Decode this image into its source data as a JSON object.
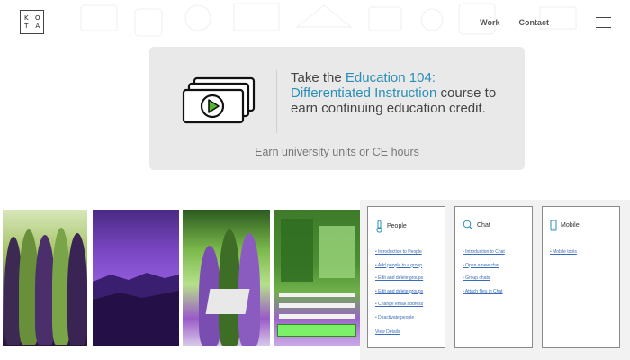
{
  "header": {
    "logo_letters": [
      "K",
      "O",
      "T",
      "A"
    ],
    "nav": [
      {
        "label": "Work"
      },
      {
        "label": "Contact"
      }
    ],
    "menu_icon": "hamburger-menu-icon"
  },
  "banner": {
    "line_prefix": "Take the ",
    "course_name": "Education 104: Differentiated Instruction",
    "line_suffix": " course to earn continuing education credit.",
    "subtext": "Earn university units or CE hours",
    "icon": "video-course-icon",
    "accent_color": "#2a8fb7"
  },
  "cards": [
    {
      "title": "People",
      "icon": "thermometer-icon",
      "links": [
        "Introduction to People",
        "Add people to a group",
        "Edit and delete groups",
        "Edit and delete groups",
        "Change email address",
        "Deactivate people"
      ],
      "footer": "View Details"
    },
    {
      "title": "Chat",
      "icon": "chat-search-icon",
      "links": [
        "Introduction to Chat",
        "Open a new chat",
        "Group chats",
        "Attach files in Chat"
      ]
    },
    {
      "title": "Mobile",
      "icon": "mobile-phone-icon",
      "links": [
        "Mobile tools"
      ]
    }
  ]
}
